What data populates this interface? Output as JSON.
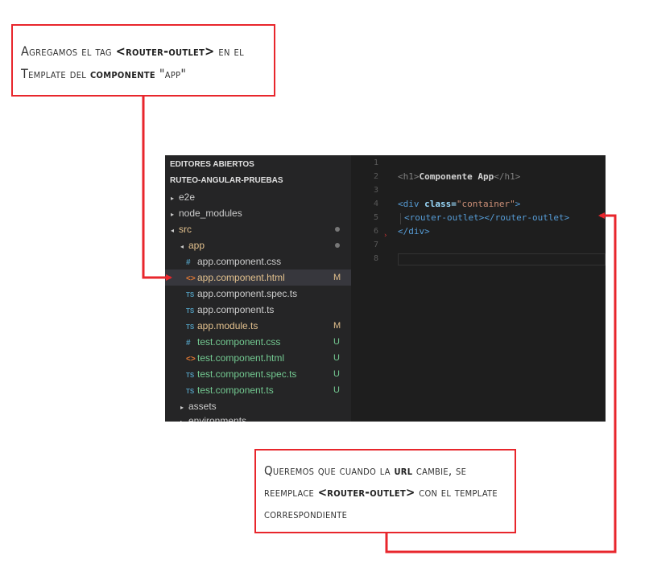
{
  "callouts": {
    "top": {
      "line1_a": "Agregamos el tag ",
      "line1_b": "<router-outlet>",
      "line1_c": " en el",
      "line2_a": "Template del ",
      "line2_b": "componente",
      "line2_c": " \"app\""
    },
    "bottom": {
      "line1_a": "Queremos que cuando la ",
      "line1_b": "url",
      "line1_c": " cambie, se",
      "line2_a": "reemplace ",
      "line2_b": "<router-outlet>",
      "line2_c": " con el template",
      "line3": "correspondiente"
    }
  },
  "sidebar": {
    "sections": [
      "EDITORES ABIERTOS",
      "RUTEO-ANGULAR-PRUEBAS"
    ],
    "items": [
      {
        "label": "e2e",
        "twisty": "▸",
        "badge": ""
      },
      {
        "label": "node_modules",
        "twisty": "▸",
        "badge": ""
      },
      {
        "label": "src",
        "twisty": "◂",
        "badge": "dot"
      },
      {
        "label": "app",
        "twisty": "◂",
        "badge": "dot"
      },
      {
        "label": "app.component.css",
        "icon": "#",
        "badge": ""
      },
      {
        "label": "app.component.html",
        "icon": "<>",
        "badge": "M"
      },
      {
        "label": "app.component.spec.ts",
        "icon": "TS",
        "badge": ""
      },
      {
        "label": "app.component.ts",
        "icon": "TS",
        "badge": ""
      },
      {
        "label": "app.module.ts",
        "icon": "TS",
        "badge": "M"
      },
      {
        "label": "test.component.css",
        "icon": "#",
        "badge": "U"
      },
      {
        "label": "test.component.html",
        "icon": "<>",
        "badge": "U"
      },
      {
        "label": "test.component.spec.ts",
        "icon": "TS",
        "badge": "U"
      },
      {
        "label": "test.component.ts",
        "icon": "TS",
        "badge": "U"
      },
      {
        "label": "assets",
        "twisty": "▸",
        "badge": ""
      },
      {
        "label": "environments",
        "twisty": "▸",
        "badge": ""
      }
    ]
  },
  "code": {
    "line_numbers": [
      "1",
      "2",
      "3",
      "4",
      "5",
      "6",
      "7",
      "8"
    ],
    "h1_open": "<h1>",
    "h1_text": "Componente App",
    "h1_close": "</h1>",
    "div_open_a": "<div",
    "div_attr": " class=",
    "div_val": "\"container\"",
    "div_open_b": ">",
    "ro_open": "<router-outlet>",
    "ro_close": "</router-outlet>",
    "div_close": "</div>"
  },
  "colors": {
    "callout_border": "#e8262c",
    "arrow": "#e8262c",
    "modified": "#e2c08d",
    "untracked": "#73c991",
    "selected": "#37373d"
  }
}
